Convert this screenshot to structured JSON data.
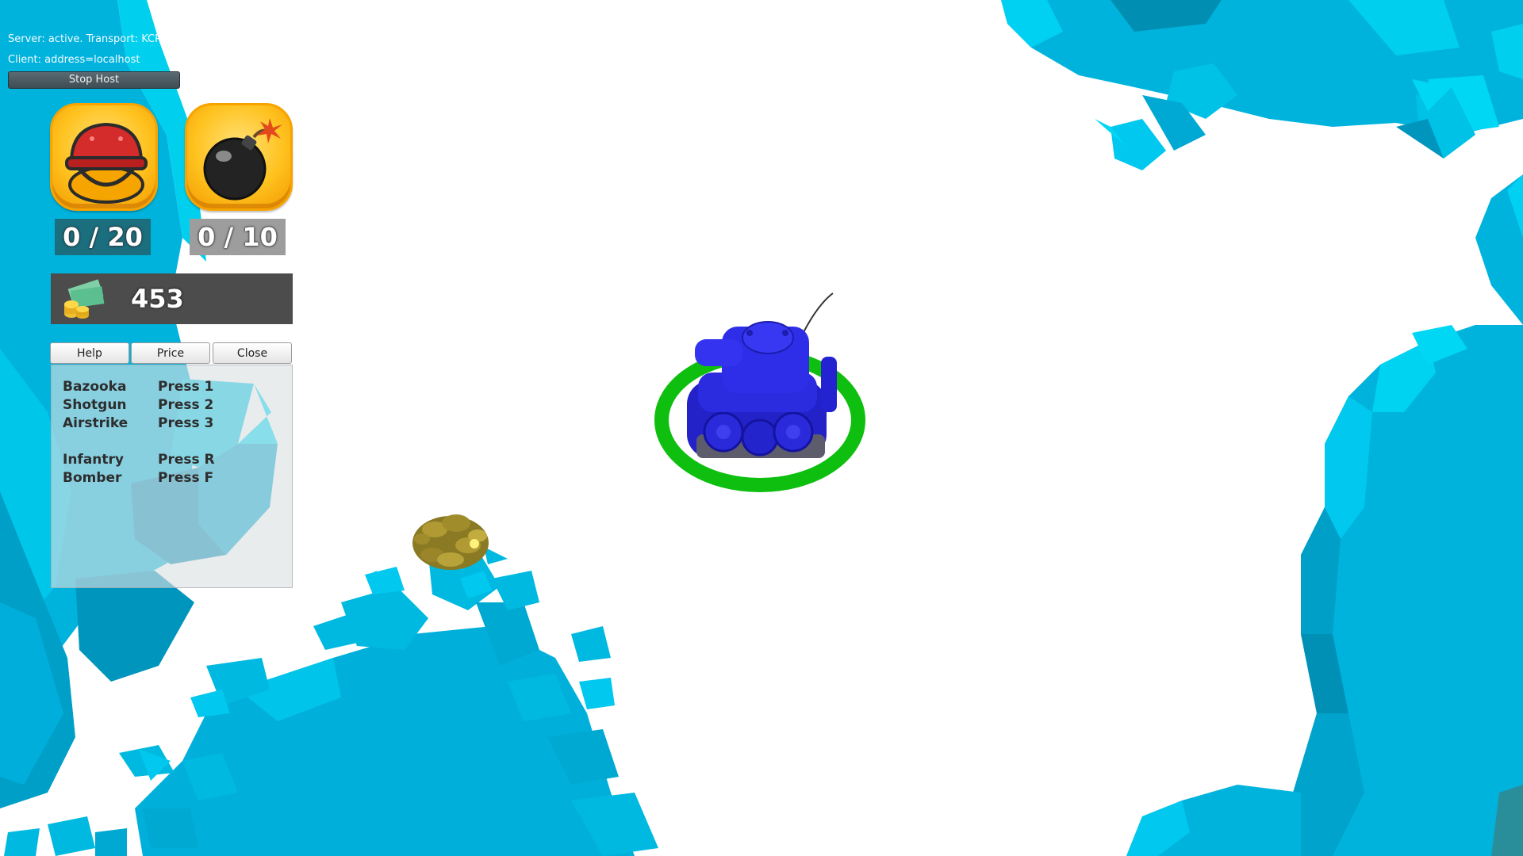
{
  "network": {
    "server_status": "Server: active. Transport: KCP",
    "client_status": "Client: address=localhost",
    "stop_host_label": "Stop Host"
  },
  "inventory": [
    {
      "icon": "helmet-icon",
      "count": "0 / 20"
    },
    {
      "icon": "bomb-icon",
      "count": "0 / 10"
    }
  ],
  "money": {
    "icon": "cash-coins-icon",
    "value": "453"
  },
  "tabs": [
    "Help",
    "Price",
    "Close"
  ],
  "help": {
    "rows": [
      {
        "name": "Bazooka",
        "key": "Press 1"
      },
      {
        "name": "Shotgun",
        "key": "Press 2"
      },
      {
        "name": "Airstrike",
        "key": "Press 3"
      },
      {
        "name": "Infantry",
        "key": "Press R"
      },
      {
        "name": "Bomber",
        "key": "Press F"
      }
    ]
  },
  "colors": {
    "ice": "#00b3dd",
    "ice_light": "#00d7f5",
    "ice_dark": "#0089ac",
    "tank": "#2323d6",
    "selection_ring": "#0fbf0f",
    "counter_active": "#1b6e7e",
    "counter_inactive": "#9d9d9d",
    "money_bar": "#4c4c4c"
  },
  "world": {
    "player_unit": "blue-tank",
    "pickup": "gold-coin-pile"
  }
}
